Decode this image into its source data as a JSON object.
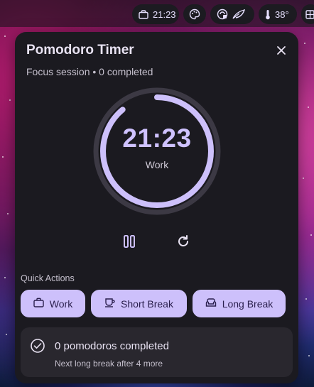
{
  "topbar": {
    "clock": "21:23",
    "temperature": "38°",
    "icons": [
      "briefcase-icon",
      "palette-icon",
      "network-icon",
      "leaf-icon",
      "thermometer-icon",
      "grid-icon"
    ]
  },
  "timer": {
    "title": "Pomodoro Timer",
    "subtitle": "Focus session • 0 completed",
    "time": "21:23",
    "mode": "Work",
    "progress": 0.89
  },
  "quick_actions": {
    "label": "Quick Actions",
    "work": "Work",
    "short_break": "Short Break",
    "long_break": "Long Break"
  },
  "stats": {
    "completed": "0 pomodoros completed",
    "next_break": "Next long break after 4 more"
  },
  "colors": {
    "accent": "#cdc0fb",
    "panel": "#1b1a20",
    "track": "#3c3944"
  }
}
